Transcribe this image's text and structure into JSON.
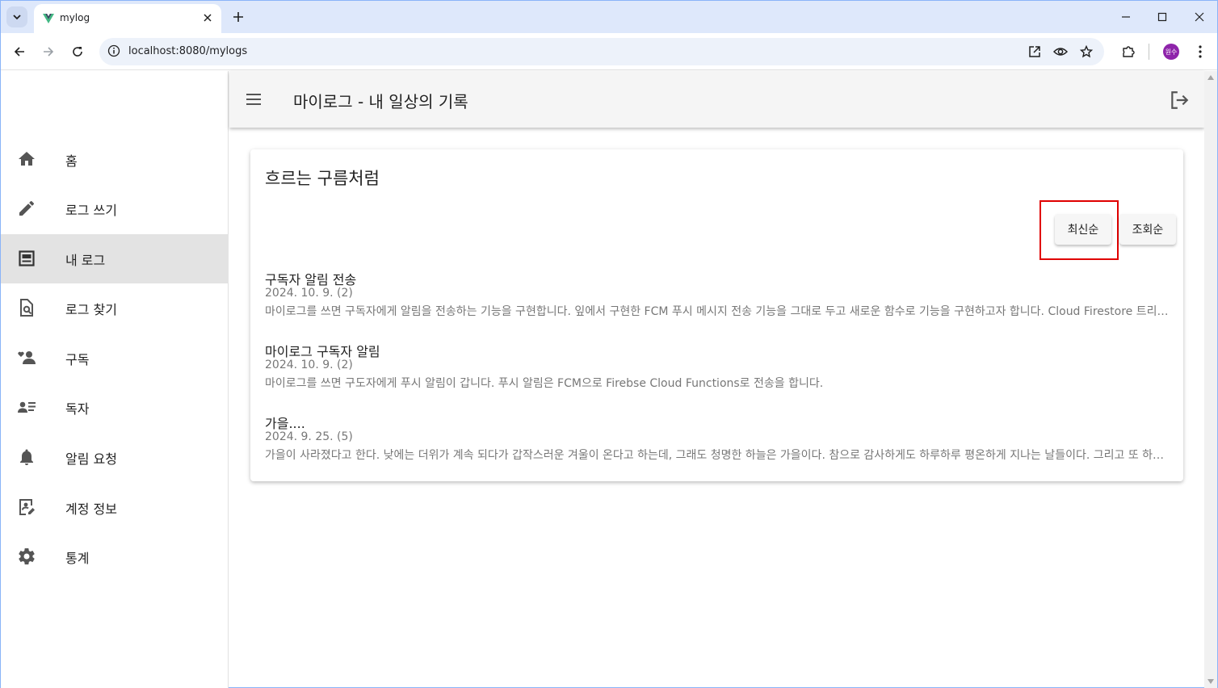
{
  "browser": {
    "tab_title": "mylog",
    "url": "localhost:8080/mylogs",
    "profile_label": "원수"
  },
  "app": {
    "title": "마이로그 - 내 일상의 기록"
  },
  "sidebar": {
    "items": [
      {
        "label": "홈",
        "icon": "home-icon"
      },
      {
        "label": "로그 쓰기",
        "icon": "pencil-icon"
      },
      {
        "label": "내 로그",
        "icon": "list-box-icon"
      },
      {
        "label": "로그 찾기",
        "icon": "file-search-icon"
      },
      {
        "label": "구독",
        "icon": "people-icon"
      },
      {
        "label": "독자",
        "icon": "reader-list-icon"
      },
      {
        "label": "알림 요청",
        "icon": "bell-icon"
      },
      {
        "label": "계정 정보",
        "icon": "account-edit-icon"
      },
      {
        "label": "통계",
        "icon": "gear-icon"
      }
    ],
    "active_index": 2
  },
  "main": {
    "blog_title": "흐르는 구름처럼",
    "sort_buttons": {
      "latest": "최신순",
      "views": "조회순"
    },
    "posts": [
      {
        "title": "구독자 알림 전송",
        "meta": "2024. 10. 9. (2)",
        "excerpt": "마이로그를 쓰면 구독자에게 알림을 전송하는 기능을 구현합니다. 잎에서 구현한 FCM 푸시 메시지 전송 기능을 그대로 두고 새로운 함수로 기능을 구현하고자 합니다. Cloud Firestore 트리거를 이용합니다."
      },
      {
        "title": "마이로그 구독자 알림",
        "meta": "2024. 10. 9. (2)",
        "excerpt": "마이로그를 쓰면 구도자에게 푸시 알림이 갑니다. 푸시 알림은 FCM으로 Firebse Cloud Functions로 전송을 합니다."
      },
      {
        "title": "가을....",
        "meta": "2024. 9. 25. (5)",
        "excerpt": "가을이 사라졌다고 한다. 낮에는 더위가 계속 되다가 갑작스러운 겨울이 온다고 하는데, 그래도 청명한 하늘은 가을이다. 참으로 감사하게도 하루하루 평온하게 지나는 날들이다. 그리고 또 하루가 간다."
      }
    ]
  }
}
